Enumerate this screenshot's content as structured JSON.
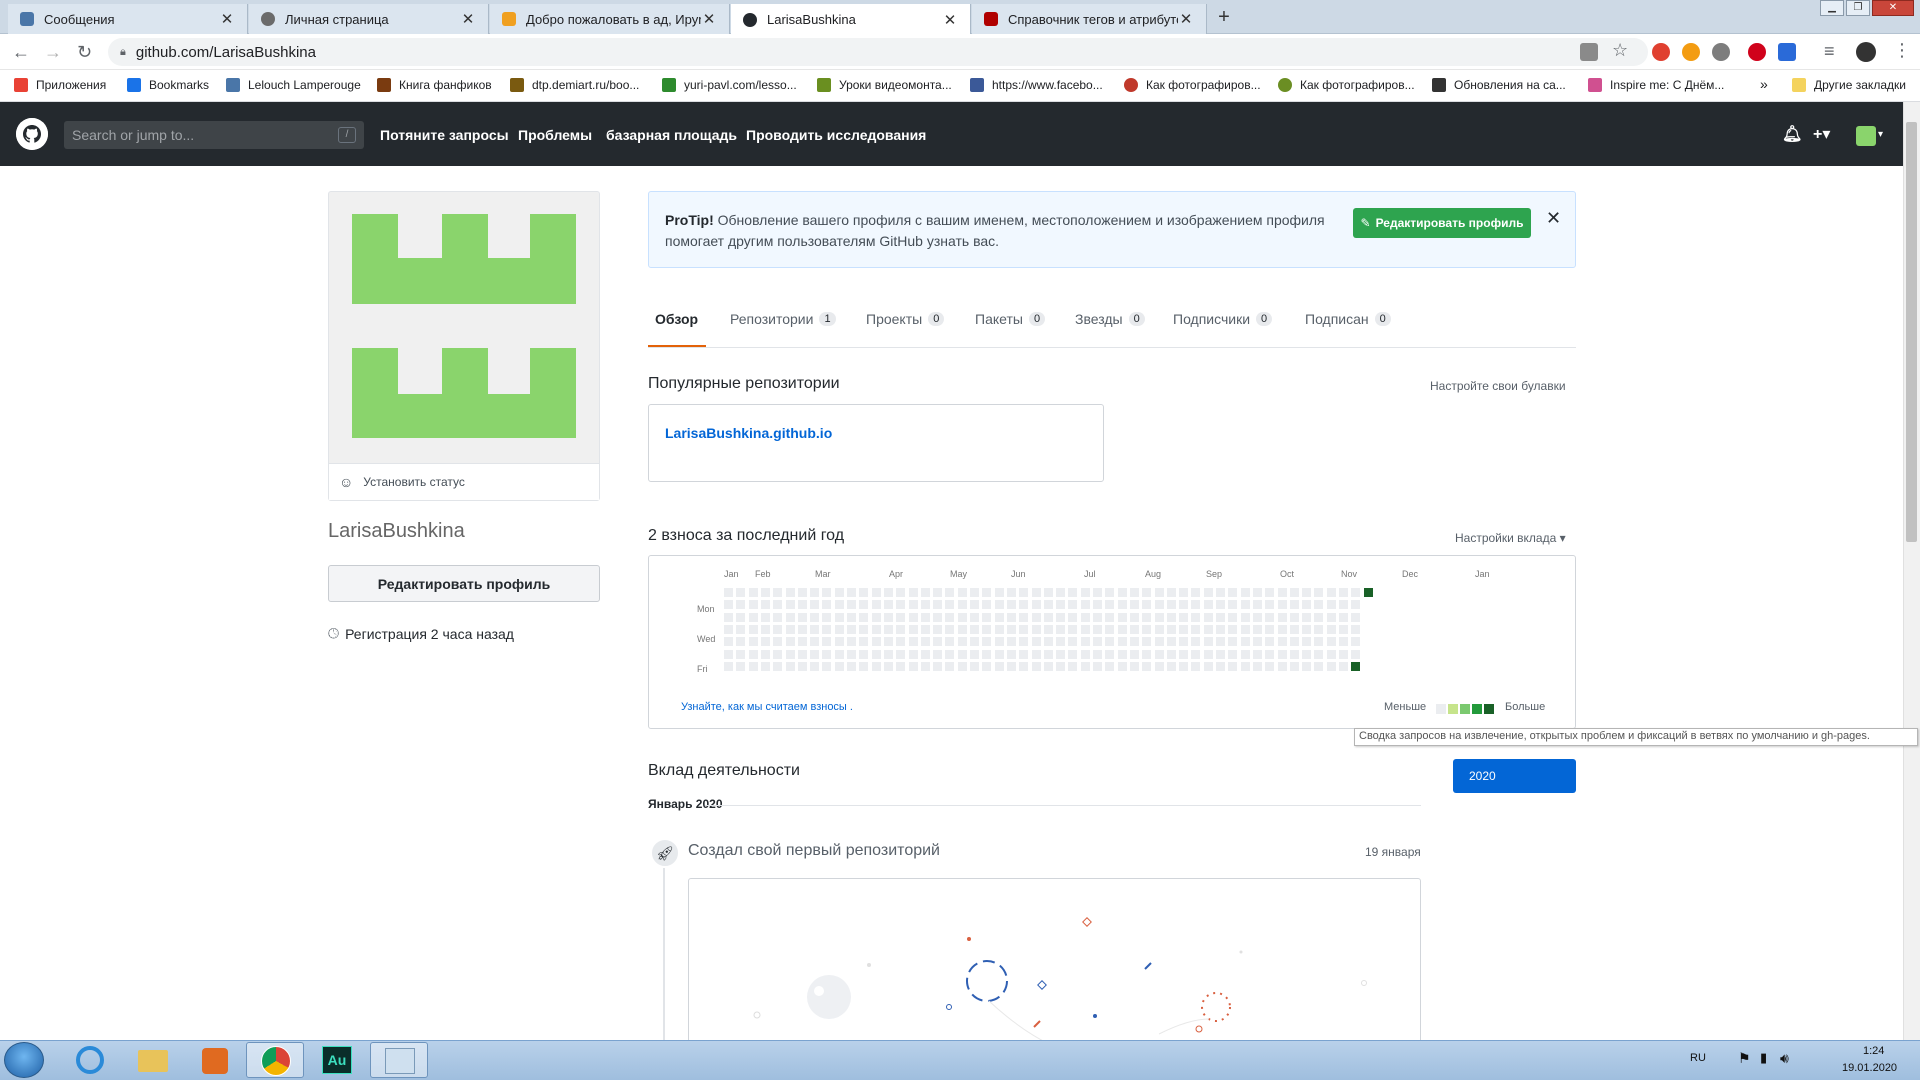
{
  "browser": {
    "tabs": [
      {
        "label": "Сообщения",
        "color": "#4a76a8",
        "active": false
      },
      {
        "label": "Личная страница",
        "color": "#6b6b6b",
        "active": false
      },
      {
        "label": "Добро пожаловать в ад, Ируma",
        "color": "#f0a020",
        "active": false
      },
      {
        "label": "LarisaBushkina",
        "color": "#24292e",
        "active": true
      },
      {
        "label": "Справочник тегов и атрибутов",
        "color": "#b00000",
        "active": false
      }
    ],
    "new_tab": "+",
    "url": "github.com/LarisaBushkina",
    "bookmarks": [
      {
        "label": "Приложения",
        "color": "#e94235"
      },
      {
        "label": "Bookmarks",
        "color": "#1a73e8"
      },
      {
        "label": "Lelouch Lamperouge",
        "color": "#4a76a8"
      },
      {
        "label": "Книга фанфиков",
        "color": "#7a3b10"
      },
      {
        "label": "dtp.demiart.ru/boo...",
        "color": "#7a5a10"
      },
      {
        "label": "yuri-pavl.com/lesso...",
        "color": "#2e8b2e"
      },
      {
        "label": "Уроки видеомонта...",
        "color": "#6a8f20"
      },
      {
        "label": "https://www.facebo...",
        "color": "#3b5998"
      },
      {
        "label": "Как фотографиров...",
        "color": "#c0392b"
      },
      {
        "label": "Как фотографиров...",
        "color": "#6b8e23"
      },
      {
        "label": "Обновления на са...",
        "color": "#333333"
      },
      {
        "label": "Inspire me: С Днём...",
        "color": "#d05090"
      }
    ],
    "bookmarks_more": "»",
    "other_bookmarks": "Другие закладки"
  },
  "github": {
    "search_placeholder": "Search or jump to...",
    "search_key": "/",
    "nav": [
      "Потяните запросы",
      "Проблемы",
      "базарная площадь",
      "Проводить исследования"
    ],
    "plus": "+▾"
  },
  "profile": {
    "set_status": "Установить статус",
    "username": "LarisaBushkina",
    "edit_button": "Редактировать профиль",
    "joined": "Регистрация 2 часа назад",
    "avatar_color": "#8ad46c"
  },
  "protip": {
    "bold": "ProTip!",
    "text": " Обновление вашего профиля с вашим именем, местоположением и изображением профиля помогает другим пользователям GitHub узнать вас.",
    "button": "Редактировать профиль",
    "close": "✕"
  },
  "tabs": [
    {
      "label": "Обзор",
      "count": ""
    },
    {
      "label": "Репозитории",
      "count": "1"
    },
    {
      "label": "Проекты",
      "count": "0"
    },
    {
      "label": "Пакеты",
      "count": "0"
    },
    {
      "label": "Звезды",
      "count": "0"
    },
    {
      "label": "Подписчики",
      "count": "0"
    },
    {
      "label": "Подписан",
      "count": "0"
    }
  ],
  "popular": {
    "title": "Популярные репозитории",
    "customize": "Настройте свои булавки",
    "repo": "LarisaBushkina.github.io"
  },
  "contributions": {
    "title": "2 взноса за последний год",
    "settings": "Настройки вклада ▾",
    "months": [
      "Jan",
      "Feb",
      "Mar",
      "Apr",
      "May",
      "Jun",
      "Jul",
      "Aug",
      "Sep",
      "Oct",
      "Nov",
      "Dec",
      "Jan"
    ],
    "days": [
      "Mon",
      "Wed",
      "Fri"
    ],
    "learn": "Узнайте, как мы считаем взносы .",
    "less": "Меньше",
    "more": "Больше",
    "tooltip": "Сводка запросов на извлечение, открытых проблем и фиксаций в ветвях по умолчанию и gh-pages.",
    "colors": [
      "#ebedf0",
      "#c6e48b",
      "#7bc96f",
      "#239a3b",
      "#196127"
    ],
    "weeks": 53
  },
  "activity": {
    "title": "Вклад деятельности",
    "year": "2020",
    "month": "Январь 2020",
    "event": "Создал свой первый репозиторий",
    "date": "19 января"
  },
  "tray": {
    "lang": "RU",
    "time": "1:24",
    "date": "19.01.2020"
  }
}
